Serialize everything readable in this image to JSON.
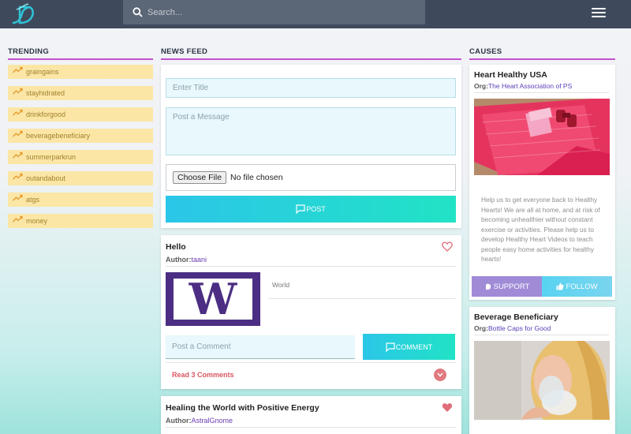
{
  "colors": {
    "topbar": "#3e4a5c",
    "accent_underline": "#c44fcf",
    "trend_bg": "#fbe6a6",
    "trend_text": "#a3822c",
    "gradient_start": "#2bc6e8",
    "gradient_end": "#21e3c5",
    "support": "#a08bd7",
    "link_red": "#d9575f"
  },
  "header": {
    "search_placeholder": "Search...",
    "logo_icon": "logo-icon",
    "menu_icon": "hamburger-icon"
  },
  "trending": {
    "title": "TRENDING",
    "items": [
      {
        "label": "graingains"
      },
      {
        "label": "stayhidrated"
      },
      {
        "label": "drinkforgood"
      },
      {
        "label": "beveragebeneficiary"
      },
      {
        "label": "summerparkrun"
      },
      {
        "label": "outandabout"
      },
      {
        "label": "atgs"
      },
      {
        "label": "money"
      }
    ]
  },
  "feed": {
    "title": "NEWS FEED",
    "form": {
      "title_placeholder": "Enter Title",
      "message_placeholder": "Post a Message",
      "file_button": "Choose File",
      "file_status": "No file chosen",
      "post_label": "POST"
    },
    "posts": [
      {
        "title": "Hello",
        "author_label": "Author:",
        "author": "taani",
        "image_letter": "W",
        "body": "World",
        "comment_placeholder": "Post a Comment",
        "comment_label": "COMMENT",
        "read_comments": "Read 3 Comments",
        "liked": false
      },
      {
        "title": "Healing the World with Positive Energy",
        "author_label": "Author:",
        "author": "AstralGnome",
        "liked": true
      }
    ]
  },
  "causes": {
    "title": "CAUSES",
    "items": [
      {
        "title": "Heart Healthy USA",
        "org_label": "Org:",
        "org": "The Heart Association of PS",
        "description": "Help us to get everyone back to Healthy Hearts! We are all at home, and at risk of becoming unhealthier without constant exercise or activities. Please help us to develop Healthy Heart Videos to teach people easy home activities for healthy hearts!",
        "support_label": "SUPPORT",
        "follow_label": "FOLLOW"
      },
      {
        "title": "Beverage Beneficiary",
        "org_label": "Org:",
        "org": "Bottle Caps for Good"
      }
    ]
  }
}
